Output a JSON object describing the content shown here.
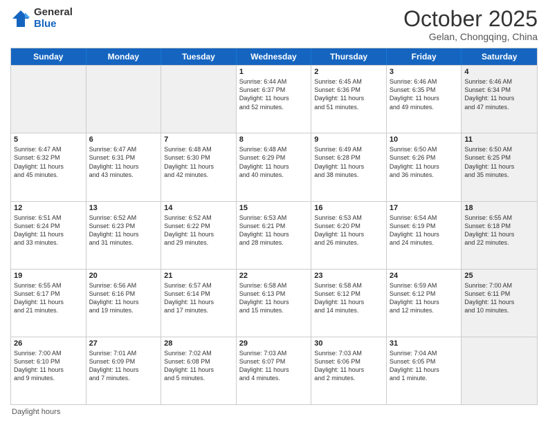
{
  "header": {
    "logo_line1": "General",
    "logo_line2": "Blue",
    "month": "October 2025",
    "location": "Gelan, Chongqing, China"
  },
  "days_of_week": [
    "Sunday",
    "Monday",
    "Tuesday",
    "Wednesday",
    "Thursday",
    "Friday",
    "Saturday"
  ],
  "weeks": [
    [
      {
        "day": "",
        "info": "",
        "shaded": true
      },
      {
        "day": "",
        "info": "",
        "shaded": true
      },
      {
        "day": "",
        "info": "",
        "shaded": true
      },
      {
        "day": "1",
        "info": "Sunrise: 6:44 AM\nSunset: 6:37 PM\nDaylight: 11 hours\nand 52 minutes."
      },
      {
        "day": "2",
        "info": "Sunrise: 6:45 AM\nSunset: 6:36 PM\nDaylight: 11 hours\nand 51 minutes."
      },
      {
        "day": "3",
        "info": "Sunrise: 6:46 AM\nSunset: 6:35 PM\nDaylight: 11 hours\nand 49 minutes."
      },
      {
        "day": "4",
        "info": "Sunrise: 6:46 AM\nSunset: 6:34 PM\nDaylight: 11 hours\nand 47 minutes.",
        "shaded": true
      }
    ],
    [
      {
        "day": "5",
        "info": "Sunrise: 6:47 AM\nSunset: 6:32 PM\nDaylight: 11 hours\nand 45 minutes."
      },
      {
        "day": "6",
        "info": "Sunrise: 6:47 AM\nSunset: 6:31 PM\nDaylight: 11 hours\nand 43 minutes."
      },
      {
        "day": "7",
        "info": "Sunrise: 6:48 AM\nSunset: 6:30 PM\nDaylight: 11 hours\nand 42 minutes."
      },
      {
        "day": "8",
        "info": "Sunrise: 6:48 AM\nSunset: 6:29 PM\nDaylight: 11 hours\nand 40 minutes."
      },
      {
        "day": "9",
        "info": "Sunrise: 6:49 AM\nSunset: 6:28 PM\nDaylight: 11 hours\nand 38 minutes."
      },
      {
        "day": "10",
        "info": "Sunrise: 6:50 AM\nSunset: 6:26 PM\nDaylight: 11 hours\nand 36 minutes."
      },
      {
        "day": "11",
        "info": "Sunrise: 6:50 AM\nSunset: 6:25 PM\nDaylight: 11 hours\nand 35 minutes.",
        "shaded": true
      }
    ],
    [
      {
        "day": "12",
        "info": "Sunrise: 6:51 AM\nSunset: 6:24 PM\nDaylight: 11 hours\nand 33 minutes."
      },
      {
        "day": "13",
        "info": "Sunrise: 6:52 AM\nSunset: 6:23 PM\nDaylight: 11 hours\nand 31 minutes."
      },
      {
        "day": "14",
        "info": "Sunrise: 6:52 AM\nSunset: 6:22 PM\nDaylight: 11 hours\nand 29 minutes."
      },
      {
        "day": "15",
        "info": "Sunrise: 6:53 AM\nSunset: 6:21 PM\nDaylight: 11 hours\nand 28 minutes."
      },
      {
        "day": "16",
        "info": "Sunrise: 6:53 AM\nSunset: 6:20 PM\nDaylight: 11 hours\nand 26 minutes."
      },
      {
        "day": "17",
        "info": "Sunrise: 6:54 AM\nSunset: 6:19 PM\nDaylight: 11 hours\nand 24 minutes."
      },
      {
        "day": "18",
        "info": "Sunrise: 6:55 AM\nSunset: 6:18 PM\nDaylight: 11 hours\nand 22 minutes.",
        "shaded": true
      }
    ],
    [
      {
        "day": "19",
        "info": "Sunrise: 6:55 AM\nSunset: 6:17 PM\nDaylight: 11 hours\nand 21 minutes."
      },
      {
        "day": "20",
        "info": "Sunrise: 6:56 AM\nSunset: 6:16 PM\nDaylight: 11 hours\nand 19 minutes."
      },
      {
        "day": "21",
        "info": "Sunrise: 6:57 AM\nSunset: 6:14 PM\nDaylight: 11 hours\nand 17 minutes."
      },
      {
        "day": "22",
        "info": "Sunrise: 6:58 AM\nSunset: 6:13 PM\nDaylight: 11 hours\nand 15 minutes."
      },
      {
        "day": "23",
        "info": "Sunrise: 6:58 AM\nSunset: 6:12 PM\nDaylight: 11 hours\nand 14 minutes."
      },
      {
        "day": "24",
        "info": "Sunrise: 6:59 AM\nSunset: 6:12 PM\nDaylight: 11 hours\nand 12 minutes."
      },
      {
        "day": "25",
        "info": "Sunrise: 7:00 AM\nSunset: 6:11 PM\nDaylight: 11 hours\nand 10 minutes.",
        "shaded": true
      }
    ],
    [
      {
        "day": "26",
        "info": "Sunrise: 7:00 AM\nSunset: 6:10 PM\nDaylight: 11 hours\nand 9 minutes."
      },
      {
        "day": "27",
        "info": "Sunrise: 7:01 AM\nSunset: 6:09 PM\nDaylight: 11 hours\nand 7 minutes."
      },
      {
        "day": "28",
        "info": "Sunrise: 7:02 AM\nSunset: 6:08 PM\nDaylight: 11 hours\nand 5 minutes."
      },
      {
        "day": "29",
        "info": "Sunrise: 7:03 AM\nSunset: 6:07 PM\nDaylight: 11 hours\nand 4 minutes."
      },
      {
        "day": "30",
        "info": "Sunrise: 7:03 AM\nSunset: 6:06 PM\nDaylight: 11 hours\nand 2 minutes."
      },
      {
        "day": "31",
        "info": "Sunrise: 7:04 AM\nSunset: 6:05 PM\nDaylight: 11 hours\nand 1 minute."
      },
      {
        "day": "",
        "info": "",
        "shaded": true
      }
    ]
  ],
  "footer": {
    "daylight_hours": "Daylight hours"
  }
}
